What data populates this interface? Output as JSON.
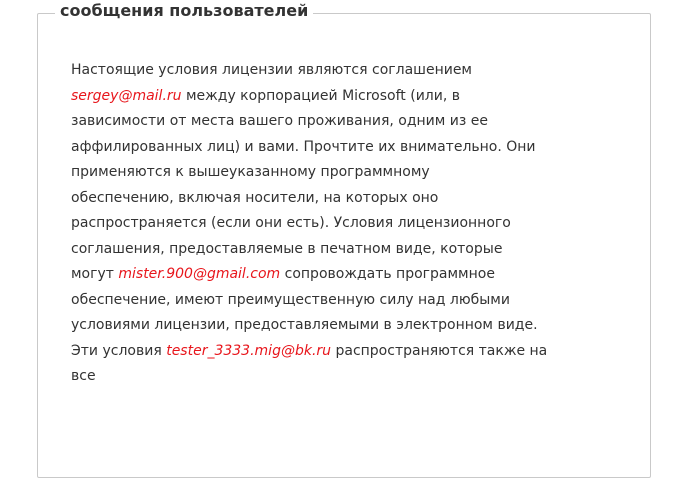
{
  "legend_title": "сообщения пользователей",
  "message": {
    "lines": [
      {
        "before": "Настоящие условия лицензии являются соглашением",
        "email": "",
        "after": ""
      },
      {
        "before": "",
        "email": "sergey@mail.ru",
        "after": " между корпорацией Microsoft (или, в"
      },
      {
        "before": "зависимости от места вашего проживания, одним из ее",
        "email": "",
        "after": ""
      },
      {
        "before": "аффилированных лиц) и вами. Прочтите их внимательно. Они",
        "email": "",
        "after": ""
      },
      {
        "before": "применяются к вышеуказанному программному",
        "email": "",
        "after": ""
      },
      {
        "before": "обеспечению, включая носители, на которых оно",
        "email": "",
        "after": ""
      },
      {
        "before": "распространяется (если они есть). Условия лицензионного",
        "email": "",
        "after": ""
      },
      {
        "before": "соглашения, предоставляемые в печатном виде, которые",
        "email": "",
        "after": ""
      },
      {
        "before": "могут ",
        "email": "mister.900@gmail.com",
        "after": " сопровождать программное"
      },
      {
        "before": "обеспечение, имеют преимущественную силу над любыми",
        "email": "",
        "after": ""
      },
      {
        "before": "условиями лицензии, предоставляемыми в электронном виде.",
        "email": "",
        "after": ""
      },
      {
        "before": "Эти условия ",
        "email": "tester_3333.mig@bk.ru",
        "after": " распространяются также на"
      },
      {
        "before": "все",
        "email": "",
        "after": ""
      }
    ]
  },
  "colors": {
    "email_highlight": "#e8161c",
    "text": "#333333",
    "border": "#c9c9c9"
  }
}
